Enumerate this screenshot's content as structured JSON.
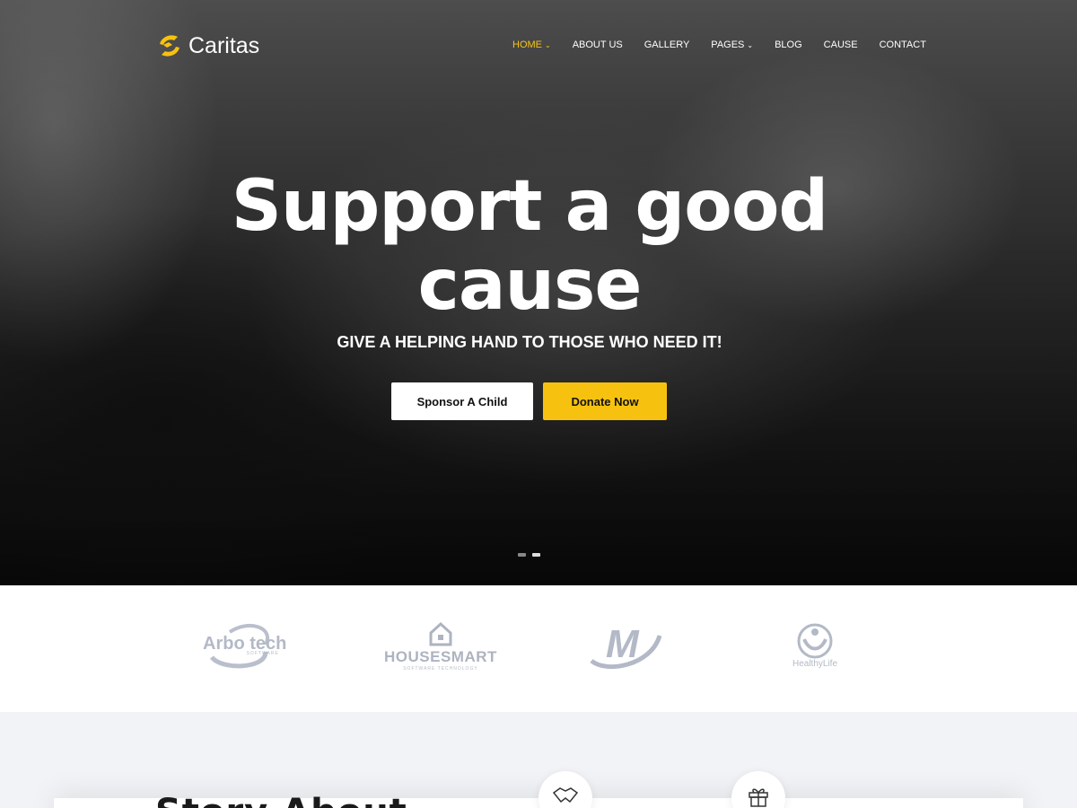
{
  "brand": {
    "name": "Caritas",
    "accent": "#f7c20f"
  },
  "nav": {
    "items": [
      {
        "label": "HOME",
        "active": true,
        "dropdown": true
      },
      {
        "label": "ABOUT US"
      },
      {
        "label": "GALLERY"
      },
      {
        "label": "PAGES",
        "dropdown": true
      },
      {
        "label": "BLOG"
      },
      {
        "label": "CAUSE"
      },
      {
        "label": "CONTACT"
      }
    ]
  },
  "hero": {
    "title": "Support a good cause",
    "subtitle": "GIVE A HELPING HAND TO THOSE WHO NEED IT!",
    "sponsor_label": "Sponsor A Child",
    "donate_label": "Donate Now",
    "slides": 2,
    "active_slide": 2
  },
  "partners": [
    {
      "name": "Arbo tech",
      "tagline": "SOFTWARE"
    },
    {
      "name": "HOUSESMART",
      "tagline": "SOFTWARE TECHNOLOGY"
    },
    {
      "name": "M"
    },
    {
      "name": "HealthyLife"
    }
  ],
  "section": {
    "heading": "Story About"
  },
  "icons": [
    "handshake-icon",
    "gift-icon"
  ]
}
